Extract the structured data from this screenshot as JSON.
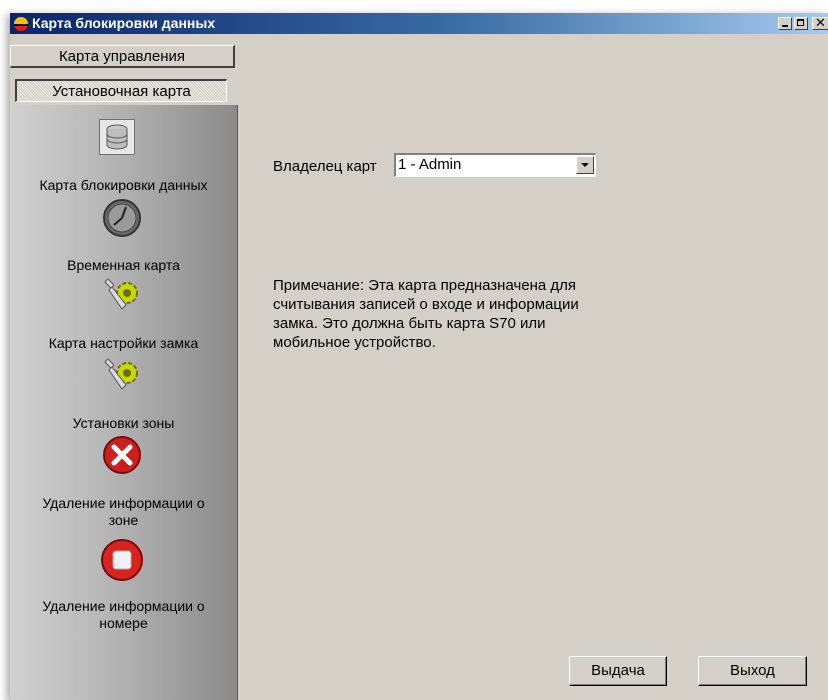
{
  "window": {
    "title": "Карта блокировки данных"
  },
  "tabs": {
    "control_card": "Карта управления",
    "setup_card": "Установочная карта"
  },
  "sidebar": {
    "items": [
      {
        "label": "Карта блокировки данных",
        "icon": "database-icon",
        "selected": true
      },
      {
        "label": "Временная карта",
        "icon": "clock-icon"
      },
      {
        "label": "Карта настройки замка",
        "icon": "wrench-gear-icon"
      },
      {
        "label": "Установки зоны",
        "icon": "wrench-gear-icon"
      },
      {
        "label_lines": [
          "Удаление информации о",
          "зоне"
        ],
        "icon": "delete-x-icon"
      },
      {
        "label_lines": [
          "Удаление информации о",
          "номере"
        ],
        "icon": "stop-icon"
      }
    ]
  },
  "main": {
    "owner_label": "Владелец карт",
    "owner_value": "1 - Admin",
    "note_lines": [
      "Примечание: Эта карта предназначена для",
      "считывания записей о входе и информации",
      "замка. Это должна быть карта S70 или",
      "мобильное устройство."
    ],
    "issue_button": "Выдача",
    "exit_button": "Выход"
  },
  "colors": {
    "titlebar_start": "#0a246a",
    "titlebar_end": "#a6caf0",
    "face": "#d4d0c8",
    "delete_red": "#cc1f1f"
  }
}
